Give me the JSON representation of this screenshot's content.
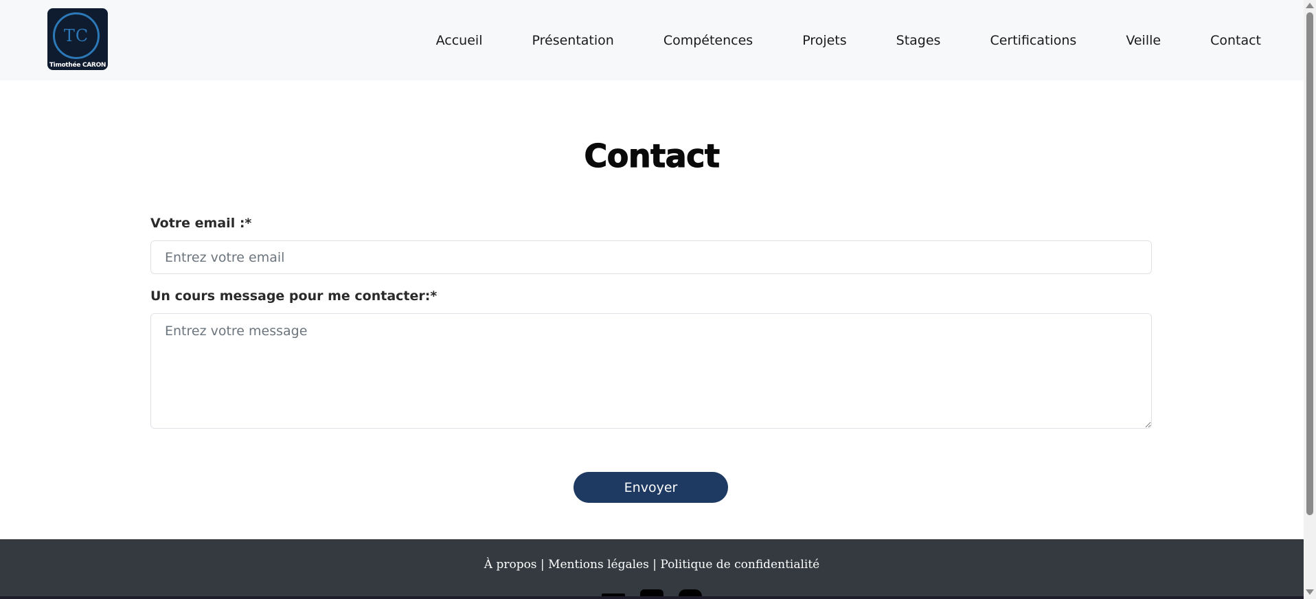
{
  "header": {
    "logo": {
      "initials": "TC",
      "name": "Timothée CARON"
    },
    "nav": [
      {
        "label": "Accueil"
      },
      {
        "label": "Présentation"
      },
      {
        "label": "Compétences"
      },
      {
        "label": "Projets"
      },
      {
        "label": "Stages"
      },
      {
        "label": "Certifications"
      },
      {
        "label": "Veille"
      },
      {
        "label": "Contact"
      }
    ]
  },
  "main": {
    "title": "Contact",
    "form": {
      "email_label": "Votre email :*",
      "email_placeholder": "Entrez votre email",
      "email_value": "",
      "message_label": "Un cours message pour me contacter:*",
      "message_placeholder": "Entrez votre message",
      "message_value": "",
      "submit_label": "Envoyer"
    }
  },
  "footer": {
    "links": [
      {
        "label": "À propos"
      },
      {
        "label": "Mentions légales"
      },
      {
        "label": "Politique de confidentialité"
      }
    ],
    "separator": " | ",
    "socials": [
      {
        "icon": "email-icon"
      },
      {
        "icon": "linkedin-icon"
      },
      {
        "icon": "github-icon"
      }
    ]
  },
  "colors": {
    "header_bg": "#f7f8fa",
    "logo_bg": "#0f1b2e",
    "logo_accent": "#2b79b8",
    "button_bg": "#1e3a63",
    "footer_bg": "#343a40"
  }
}
